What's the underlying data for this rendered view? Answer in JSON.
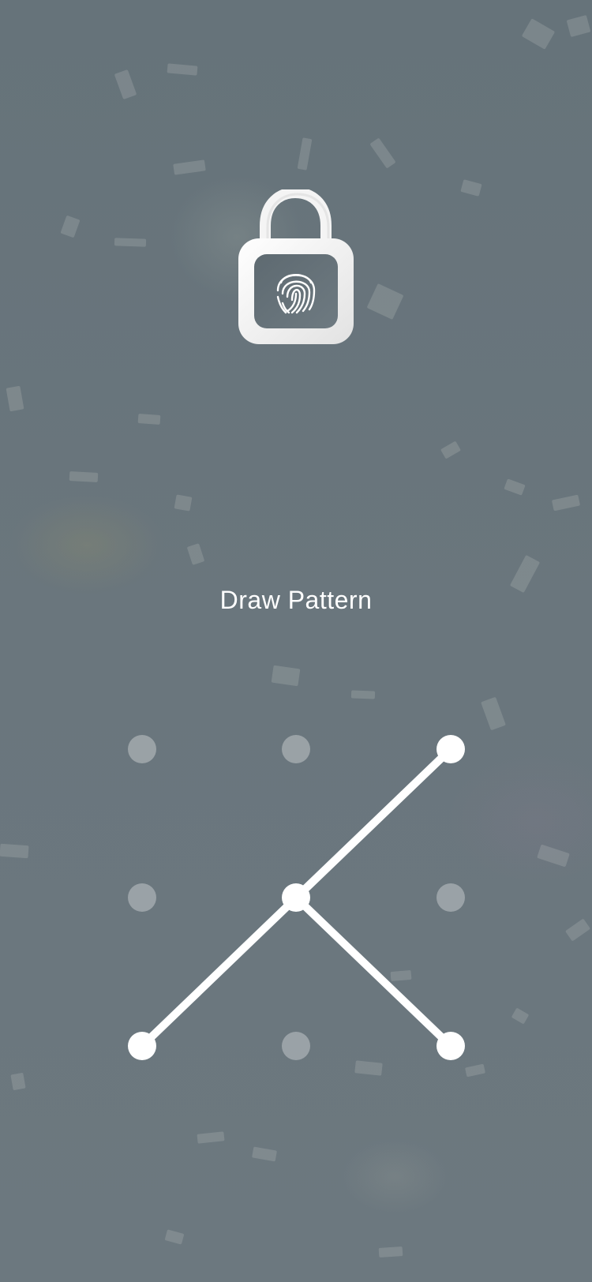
{
  "screen": {
    "title": "Draw Pattern",
    "background_color": "#6b777e",
    "accent_color": "#ffffff"
  },
  "lock": {
    "icon": "padlock-open-fingerprint-icon",
    "state": "unlocked"
  },
  "pattern_grid": {
    "rows": 3,
    "cols": 3,
    "selected_sequence": [
      6,
      2,
      4,
      8
    ]
  }
}
